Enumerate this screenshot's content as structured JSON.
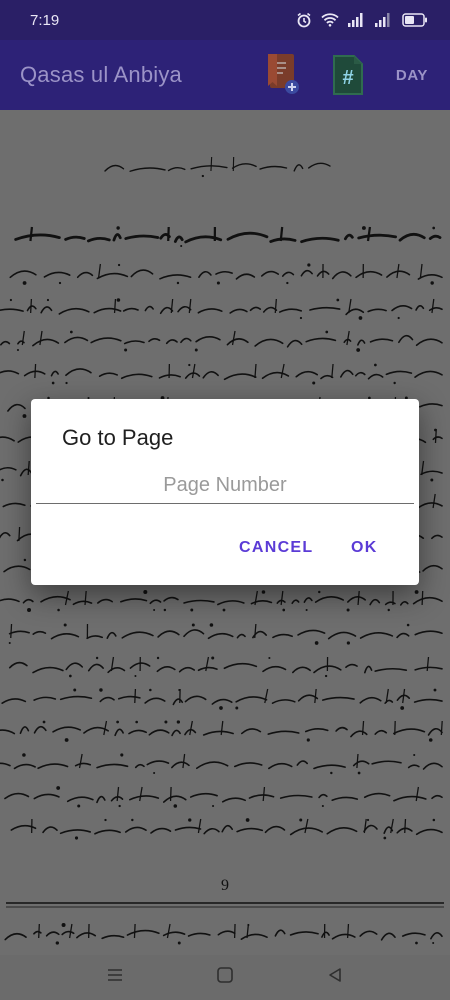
{
  "status_bar": {
    "time": "7:19",
    "icons": [
      "alarm-icon",
      "wifi-icon",
      "signal-icon",
      "signal-icon",
      "battery-icon"
    ]
  },
  "app_bar": {
    "title": "Qasas ul Anbiya",
    "actions": {
      "bookmark_icon": "add-bookmark-icon",
      "index_icon": "hash-document-icon",
      "day_label": "DAY"
    }
  },
  "page": {
    "page_number": "9"
  },
  "dialog": {
    "title": "Go to Page",
    "input": {
      "value": "",
      "placeholder": "Page Number"
    },
    "cancel_label": "CANCEL",
    "ok_label": "OK"
  },
  "colors": {
    "status_bar": "#2a1f66",
    "app_bar": "#2d2277",
    "accent": "#5b3bd6",
    "page": "#6e6e6e"
  }
}
